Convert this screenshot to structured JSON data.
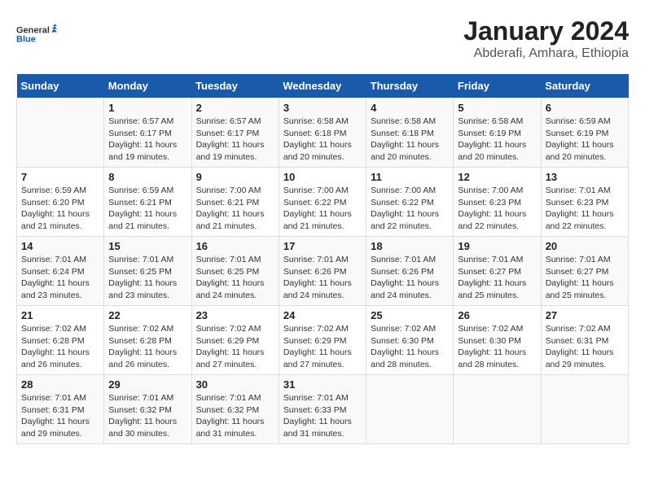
{
  "logo": {
    "line1": "General",
    "line2": "Blue"
  },
  "title": "January 2024",
  "subtitle": "Abderafi, Amhara, Ethiopia",
  "days_of_week": [
    "Sunday",
    "Monday",
    "Tuesday",
    "Wednesday",
    "Thursday",
    "Friday",
    "Saturday"
  ],
  "weeks": [
    [
      {
        "day": "",
        "info": ""
      },
      {
        "day": "1",
        "info": "Sunrise: 6:57 AM\nSunset: 6:17 PM\nDaylight: 11 hours\nand 19 minutes."
      },
      {
        "day": "2",
        "info": "Sunrise: 6:57 AM\nSunset: 6:17 PM\nDaylight: 11 hours\nand 19 minutes."
      },
      {
        "day": "3",
        "info": "Sunrise: 6:58 AM\nSunset: 6:18 PM\nDaylight: 11 hours\nand 20 minutes."
      },
      {
        "day": "4",
        "info": "Sunrise: 6:58 AM\nSunset: 6:18 PM\nDaylight: 11 hours\nand 20 minutes."
      },
      {
        "day": "5",
        "info": "Sunrise: 6:58 AM\nSunset: 6:19 PM\nDaylight: 11 hours\nand 20 minutes."
      },
      {
        "day": "6",
        "info": "Sunrise: 6:59 AM\nSunset: 6:19 PM\nDaylight: 11 hours\nand 20 minutes."
      }
    ],
    [
      {
        "day": "7",
        "info": "Sunrise: 6:59 AM\nSunset: 6:20 PM\nDaylight: 11 hours\nand 21 minutes."
      },
      {
        "day": "8",
        "info": "Sunrise: 6:59 AM\nSunset: 6:21 PM\nDaylight: 11 hours\nand 21 minutes."
      },
      {
        "day": "9",
        "info": "Sunrise: 7:00 AM\nSunset: 6:21 PM\nDaylight: 11 hours\nand 21 minutes."
      },
      {
        "day": "10",
        "info": "Sunrise: 7:00 AM\nSunset: 6:22 PM\nDaylight: 11 hours\nand 21 minutes."
      },
      {
        "day": "11",
        "info": "Sunrise: 7:00 AM\nSunset: 6:22 PM\nDaylight: 11 hours\nand 22 minutes."
      },
      {
        "day": "12",
        "info": "Sunrise: 7:00 AM\nSunset: 6:23 PM\nDaylight: 11 hours\nand 22 minutes."
      },
      {
        "day": "13",
        "info": "Sunrise: 7:01 AM\nSunset: 6:23 PM\nDaylight: 11 hours\nand 22 minutes."
      }
    ],
    [
      {
        "day": "14",
        "info": "Sunrise: 7:01 AM\nSunset: 6:24 PM\nDaylight: 11 hours\nand 23 minutes."
      },
      {
        "day": "15",
        "info": "Sunrise: 7:01 AM\nSunset: 6:25 PM\nDaylight: 11 hours\nand 23 minutes."
      },
      {
        "day": "16",
        "info": "Sunrise: 7:01 AM\nSunset: 6:25 PM\nDaylight: 11 hours\nand 24 minutes."
      },
      {
        "day": "17",
        "info": "Sunrise: 7:01 AM\nSunset: 6:26 PM\nDaylight: 11 hours\nand 24 minutes."
      },
      {
        "day": "18",
        "info": "Sunrise: 7:01 AM\nSunset: 6:26 PM\nDaylight: 11 hours\nand 24 minutes."
      },
      {
        "day": "19",
        "info": "Sunrise: 7:01 AM\nSunset: 6:27 PM\nDaylight: 11 hours\nand 25 minutes."
      },
      {
        "day": "20",
        "info": "Sunrise: 7:01 AM\nSunset: 6:27 PM\nDaylight: 11 hours\nand 25 minutes."
      }
    ],
    [
      {
        "day": "21",
        "info": "Sunrise: 7:02 AM\nSunset: 6:28 PM\nDaylight: 11 hours\nand 26 minutes."
      },
      {
        "day": "22",
        "info": "Sunrise: 7:02 AM\nSunset: 6:28 PM\nDaylight: 11 hours\nand 26 minutes."
      },
      {
        "day": "23",
        "info": "Sunrise: 7:02 AM\nSunset: 6:29 PM\nDaylight: 11 hours\nand 27 minutes."
      },
      {
        "day": "24",
        "info": "Sunrise: 7:02 AM\nSunset: 6:29 PM\nDaylight: 11 hours\nand 27 minutes."
      },
      {
        "day": "25",
        "info": "Sunrise: 7:02 AM\nSunset: 6:30 PM\nDaylight: 11 hours\nand 28 minutes."
      },
      {
        "day": "26",
        "info": "Sunrise: 7:02 AM\nSunset: 6:30 PM\nDaylight: 11 hours\nand 28 minutes."
      },
      {
        "day": "27",
        "info": "Sunrise: 7:02 AM\nSunset: 6:31 PM\nDaylight: 11 hours\nand 29 minutes."
      }
    ],
    [
      {
        "day": "28",
        "info": "Sunrise: 7:01 AM\nSunset: 6:31 PM\nDaylight: 11 hours\nand 29 minutes."
      },
      {
        "day": "29",
        "info": "Sunrise: 7:01 AM\nSunset: 6:32 PM\nDaylight: 11 hours\nand 30 minutes."
      },
      {
        "day": "30",
        "info": "Sunrise: 7:01 AM\nSunset: 6:32 PM\nDaylight: 11 hours\nand 31 minutes."
      },
      {
        "day": "31",
        "info": "Sunrise: 7:01 AM\nSunset: 6:33 PM\nDaylight: 11 hours\nand 31 minutes."
      },
      {
        "day": "",
        "info": ""
      },
      {
        "day": "",
        "info": ""
      },
      {
        "day": "",
        "info": ""
      }
    ]
  ]
}
